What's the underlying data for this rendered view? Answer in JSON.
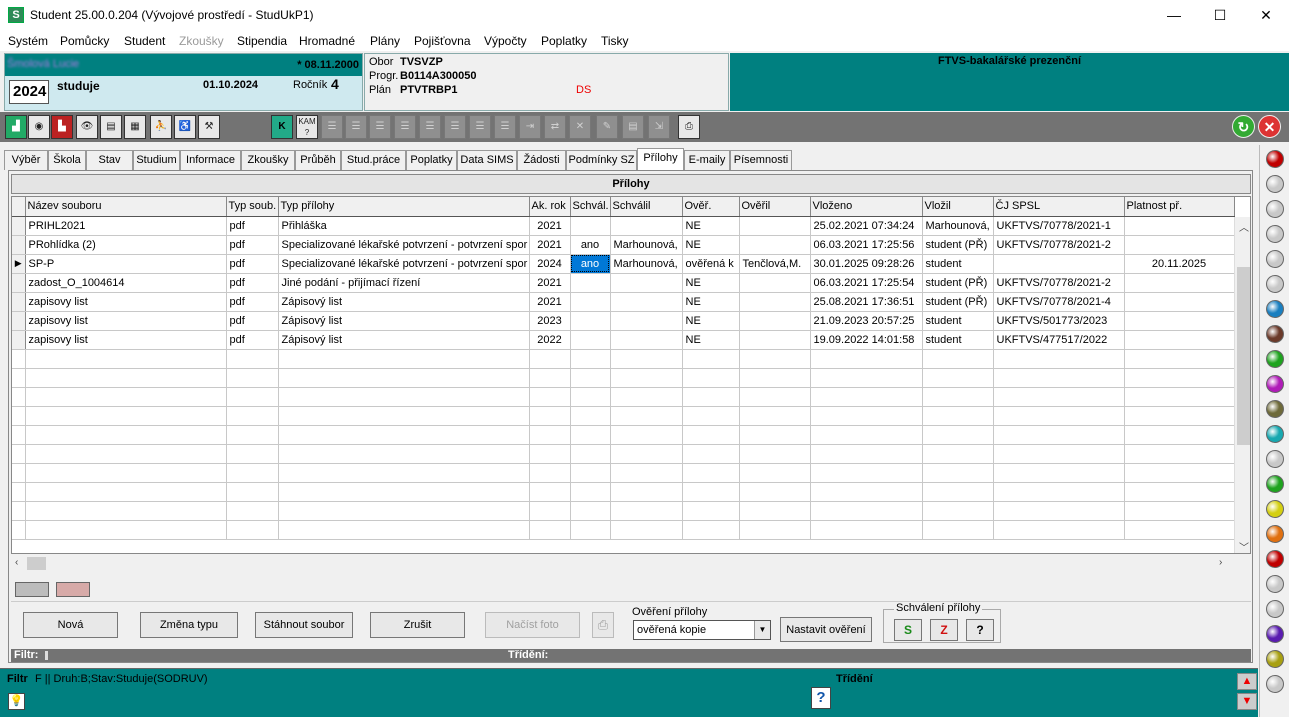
{
  "window": {
    "title": "Student   25.00.0.204  (Vývojové prostředí - StudUkP1)",
    "minimize": "—",
    "maximize": "☐",
    "close": "✕"
  },
  "menu": [
    {
      "label": "Systém",
      "disabled": false
    },
    {
      "label": "Pomůcky",
      "disabled": false
    },
    {
      "label": "Student",
      "disabled": false
    },
    {
      "label": "Zkoušky",
      "disabled": true
    },
    {
      "label": "Stipendia",
      "disabled": false
    },
    {
      "label": "Hromadné",
      "disabled": false
    },
    {
      "label": "Plány",
      "disabled": false
    },
    {
      "label": "Pojišťovna",
      "disabled": false
    },
    {
      "label": "Výpočty",
      "disabled": false
    },
    {
      "label": "Poplatky",
      "disabled": false
    },
    {
      "label": "Tisky",
      "disabled": false
    }
  ],
  "student": {
    "name": "Šmolová Lucie",
    "birth": "* 08.11.2000",
    "year": "2024",
    "status": "studuje",
    "date": "01.10.2024",
    "rocnik_label": "Ročník",
    "rocnik": "4"
  },
  "study": {
    "obor_label": "Obor",
    "obor": "TVSVZP",
    "progr_label": "Progr.",
    "progr": "B0114A300050",
    "plan_label": "Plán",
    "plan": "PTVTRBP1",
    "ds": "DS"
  },
  "program_name": "FTVS-bakalářské prezenční",
  "tabs": [
    "Výběr",
    "Škola",
    "Stav",
    "Studium",
    "Informace",
    "Zkoušky",
    "Průběh",
    "Stud.práce",
    "Poplatky",
    "Data SIMS",
    "Žádosti",
    "Podmínky SZ",
    "Přílohy",
    "E-maily",
    "Písemnosti"
  ],
  "active_tab": "Přílohy",
  "grid": {
    "title": "Přílohy",
    "columns": [
      "Název souboru",
      "Typ soub.",
      "Typ přílohy",
      "Ak. rok",
      "Schvál.",
      "Schválil",
      "Ověř.",
      "Ověřil",
      "Vloženo",
      "Vložil",
      "ČJ SPSL",
      "Platnost př."
    ],
    "rows": [
      [
        "PRIHL2021",
        "pdf",
        "Přihláška",
        "2021",
        "",
        "",
        "NE",
        "",
        "25.02.2021 07:34:24",
        "Marhounová,",
        "UKFTVS/70778/2021-1",
        ""
      ],
      [
        "PRohlídka (2)",
        "pdf",
        "Specializované lékařské potvrzení - potvrzení spor",
        "2021",
        "ano",
        "Marhounová,",
        "NE",
        "",
        "06.03.2021 17:25:56",
        "student (PŘ)",
        "UKFTVS/70778/2021-2",
        ""
      ],
      [
        "SP-P",
        "pdf",
        "Specializované lékařské potvrzení - potvrzení spor",
        "2024",
        "ano",
        "Marhounová,",
        "ověřená k",
        "Tenčlová,M.",
        "30.01.2025 09:28:26",
        "student",
        "",
        "20.11.2025"
      ],
      [
        "zadost_O_1004614",
        "pdf",
        "Jiné podání - přijímací řízení",
        "2021",
        "",
        "",
        "NE",
        "",
        "06.03.2021 17:25:54",
        "student (PŘ)",
        "UKFTVS/70778/2021-2",
        ""
      ],
      [
        "zapisovy list",
        "pdf",
        "Zápisový list",
        "2021",
        "",
        "",
        "NE",
        "",
        "25.08.2021 17:36:51",
        "student (PŘ)",
        "UKFTVS/70778/2021-4",
        ""
      ],
      [
        "zapisovy list",
        "pdf",
        "Zápisový list",
        "2023",
        "",
        "",
        "NE",
        "",
        "21.09.2023 20:57:25",
        "student",
        "UKFTVS/501773/2023",
        ""
      ],
      [
        "zapisovy list",
        "pdf",
        "Zápisový list",
        "2022",
        "",
        "",
        "NE",
        "",
        "19.09.2022 14:01:58",
        "student",
        "UKFTVS/477517/2022",
        ""
      ]
    ],
    "selected_row": 2
  },
  "buttons": {
    "nova": "Nová",
    "zmena_typu": "Změna typu",
    "stahnout": "Stáhnout soubor",
    "zrusit": "Zrušit",
    "nacist_foto": "Načíst foto",
    "overeni_label": "Ověření přílohy",
    "overeni_value": "ověřená kopie",
    "nastavit_overeni": "Nastavit ověření",
    "schvaleni_label": "Schválení přílohy",
    "schvalit": "S",
    "zamitnout": "Z",
    "otaznik": "?"
  },
  "filterbar": {
    "filtr_label": "Filtr:",
    "trideni_label": "Třídění:"
  },
  "bottom": {
    "filtr_label": "Filtr",
    "filtr_value": "F || Druh:B;Stav:Studuje(SODRUV)",
    "trideni_label": "Třídění"
  },
  "toolbar_icons": [
    "students-icon",
    "record-icon",
    "copy-icon",
    "eye-icon",
    "form-icon",
    "grid-icon",
    "people-icon",
    "stroller-icon",
    "graduate-icon"
  ],
  "sidebar_balls": [
    "#c00000",
    "#c8c8c8",
    "#c8c8c8",
    "#c8c8c8",
    "#c8c8c8",
    "#c8c8c8",
    "#1a7fc0",
    "#6b3a2a",
    "#1fa31f",
    "#b01cb8",
    "#6e6a3a",
    "#18a8b0",
    "#c8c8c8",
    "#1fa31f",
    "#d4cf12",
    "#e07010",
    "#c00000",
    "#c8c8c8",
    "#c8c8c8",
    "#5a1cb0",
    "#a8a012",
    "#c8c8c8"
  ]
}
